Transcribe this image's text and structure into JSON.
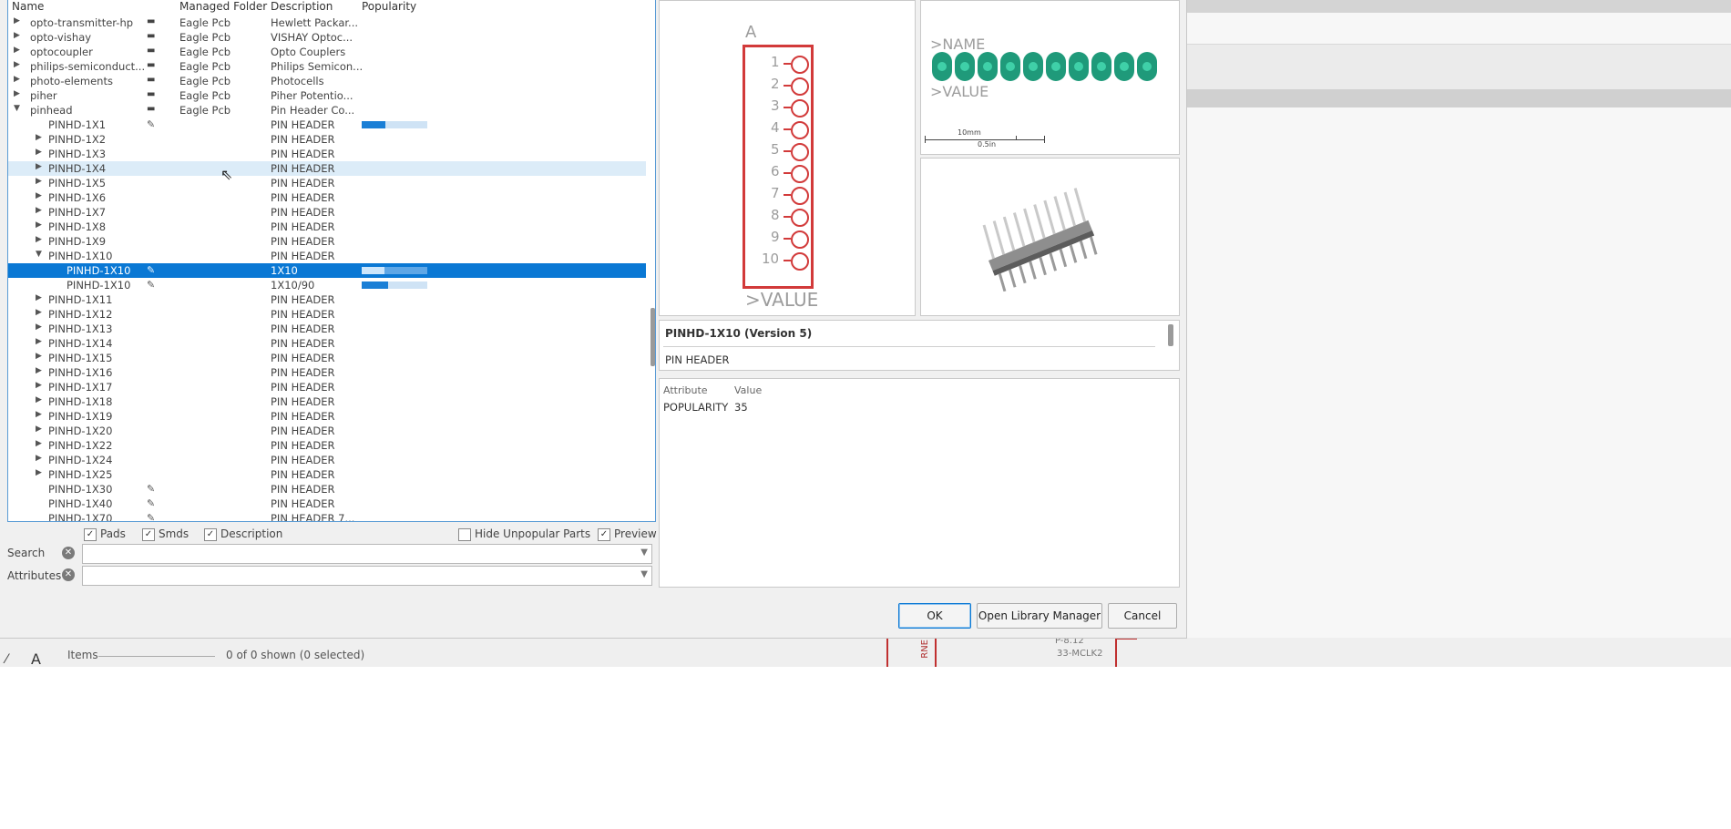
{
  "tree": {
    "headers": {
      "name": "Name",
      "folder": "Managed Folder",
      "description": "Description",
      "popularity": "Popularity"
    },
    "libraries": [
      {
        "name": "opto-transmitter-hp",
        "folder": "Eagle Pcb",
        "description": "Hewlett Packar..."
      },
      {
        "name": "opto-vishay",
        "folder": "Eagle Pcb",
        "description": "VISHAY Optoc..."
      },
      {
        "name": "optocoupler",
        "folder": "Eagle Pcb",
        "description": "Opto Couplers"
      },
      {
        "name": "philips-semiconduct...",
        "folder": "Eagle Pcb",
        "description": "Philips Semicon..."
      },
      {
        "name": "photo-elements",
        "folder": "Eagle Pcb",
        "description": "Photocells"
      },
      {
        "name": "piher",
        "folder": "Eagle Pcb",
        "description": "Piher Potentio..."
      },
      {
        "name": "pinhead",
        "folder": "Eagle Pcb",
        "description": "Pin Header Co..."
      }
    ],
    "devices": [
      {
        "name": "PINHD-1X1",
        "description": "PIN HEADER",
        "popularity": 0.36
      },
      {
        "name": "PINHD-1X2",
        "description": "PIN HEADER"
      },
      {
        "name": "PINHD-1X3",
        "description": "PIN HEADER"
      },
      {
        "name": "PINHD-1X4",
        "description": "PIN HEADER"
      },
      {
        "name": "PINHD-1X5",
        "description": "PIN HEADER"
      },
      {
        "name": "PINHD-1X6",
        "description": "PIN HEADER"
      },
      {
        "name": "PINHD-1X7",
        "description": "PIN HEADER"
      },
      {
        "name": "PINHD-1X8",
        "description": "PIN HEADER"
      },
      {
        "name": "PINHD-1X9",
        "description": "PIN HEADER"
      },
      {
        "name": "PINHD-1X10",
        "description": "PIN HEADER"
      },
      {
        "name": "PINHD-1X10",
        "description": "1X10",
        "popularity": 0.35
      },
      {
        "name": "PINHD-1X10",
        "description": "1X10/90",
        "popularity": 0.4
      },
      {
        "name": "PINHD-1X11",
        "description": "PIN HEADER"
      },
      {
        "name": "PINHD-1X12",
        "description": "PIN HEADER"
      },
      {
        "name": "PINHD-1X13",
        "description": "PIN HEADER"
      },
      {
        "name": "PINHD-1X14",
        "description": "PIN HEADER"
      },
      {
        "name": "PINHD-1X15",
        "description": "PIN HEADER"
      },
      {
        "name": "PINHD-1X16",
        "description": "PIN HEADER"
      },
      {
        "name": "PINHD-1X17",
        "description": "PIN HEADER"
      },
      {
        "name": "PINHD-1X18",
        "description": "PIN HEADER"
      },
      {
        "name": "PINHD-1X19",
        "description": "PIN HEADER"
      },
      {
        "name": "PINHD-1X20",
        "description": "PIN HEADER"
      },
      {
        "name": "PINHD-1X22",
        "description": "PIN HEADER"
      },
      {
        "name": "PINHD-1X24",
        "description": "PIN HEADER"
      },
      {
        "name": "PINHD-1X25",
        "description": "PIN HEADER"
      },
      {
        "name": "PINHD-1X30",
        "description": "PIN HEADER"
      },
      {
        "name": "PINHD-1X40",
        "description": "PIN HEADER"
      },
      {
        "name": "PINHD-1X70",
        "description": "PIN HEADER 7..."
      }
    ]
  },
  "options": {
    "pads": "Pads",
    "smds": "Smds",
    "description": "Description",
    "hide_unpopular": "Hide Unpopular Parts",
    "preview": "Preview",
    "search_label": "Search",
    "attributes_label": "Attributes"
  },
  "symbol": {
    "gate_name": "A",
    "value_label": ">VALUE",
    "pins": [
      "1",
      "2",
      "3",
      "4",
      "5",
      "6",
      "7",
      "8",
      "9",
      "10"
    ]
  },
  "footprint": {
    "name_label": ">NAME",
    "value_label": ">VALUE",
    "scale_unit": "10mm",
    "scale_value": "0.5in"
  },
  "details": {
    "title": "PINHD-1X10 (Version 5)",
    "description": "PIN HEADER",
    "attr_header_name": "Attribute",
    "attr_header_value": "Value",
    "attributes": [
      {
        "name": "POPULARITY",
        "value": "35"
      }
    ]
  },
  "buttons": {
    "ok": "OK",
    "open_library_manager": "Open Library Manager",
    "cancel": "Cancel"
  },
  "statusbar": {
    "items_label": "Items",
    "items_count": "0 of 0 shown (0 selected)"
  },
  "schematic": {
    "label_1": "P-8.12",
    "label_2": "33-MCLK2",
    "label_3": "RNE"
  },
  "colors": {
    "selection": "#0a78d4",
    "hover": "#dcecf8",
    "symbol_red": "#d23a3a",
    "pad_green": "#1f9a7a",
    "popularity_blue": "#1a7fd6"
  }
}
